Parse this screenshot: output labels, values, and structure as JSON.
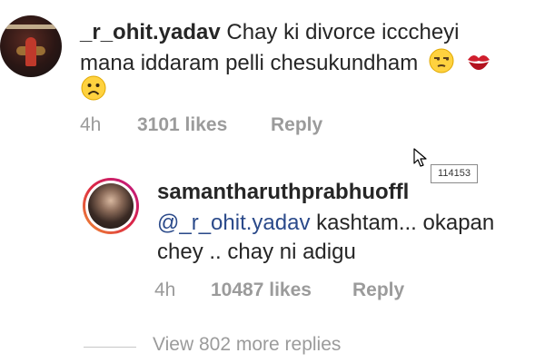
{
  "comment": {
    "username": "_r_ohit.yadav",
    "text_line1": "Chay ki divorce icccheyi",
    "text_line2": "mana iddaram pelli chesukundham",
    "emoji_after_line2": [
      "unamused-face",
      "kiss-mark"
    ],
    "emoji_line3": "frowning-face",
    "time": "4h",
    "likes": "3101 likes",
    "reply_label": "Reply"
  },
  "reply": {
    "username": "samantharuthprabhuoffl",
    "mention": "@_r_ohit.yadav",
    "text_line2_rest": " kashtam... okapan",
    "text_line3": "chey .. chay ni adigu",
    "time": "4h",
    "likes": "10487 likes",
    "reply_label": "Reply"
  },
  "tooltip": {
    "text": "114153"
  },
  "view_more": {
    "label": "View 802 more replies"
  },
  "colors": {
    "mention": "#2b4a8a",
    "meta": "#9b9b9b",
    "text": "#262626"
  }
}
